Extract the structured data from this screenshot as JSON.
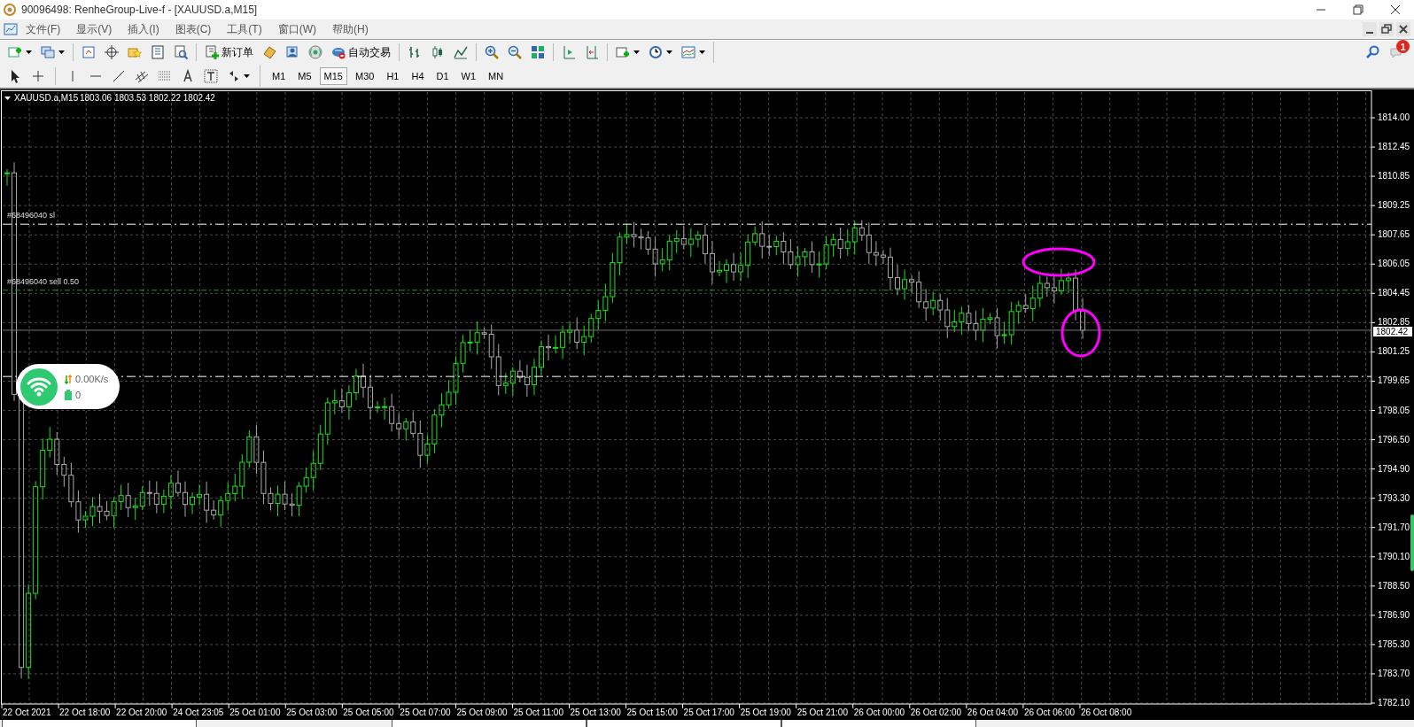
{
  "window": {
    "title": "90096498: RenheGroup-Live-f - [XAUUSD.a,M15]"
  },
  "menu": [
    "文件(F)",
    "显示(V)",
    "插入(I)",
    "图表(C)",
    "工具(T)",
    "窗口(W)",
    "帮助(H)"
  ],
  "toolbar": {
    "new_order": "新订单",
    "auto_trading": "自动交易",
    "notification_count": "1"
  },
  "timeframes": [
    {
      "label": "M1",
      "selected": false
    },
    {
      "label": "M5",
      "selected": false
    },
    {
      "label": "M15",
      "selected": true
    },
    {
      "label": "M30",
      "selected": false
    },
    {
      "label": "H1",
      "selected": false
    },
    {
      "label": "H4",
      "selected": false
    },
    {
      "label": "D1",
      "selected": false
    },
    {
      "label": "W1",
      "selected": false
    },
    {
      "label": "MN",
      "selected": false
    }
  ],
  "chart": {
    "symbol": "XAUUSD.a,M15",
    "ohlc": "1803.06 1803.53 1802.22 1802.42",
    "order_lines": [
      {
        "kind": "stop_loss",
        "label": "#68496040 sl"
      },
      {
        "kind": "order",
        "label": "#68496040 sell 0.50"
      },
      {
        "kind": "take_profit"
      }
    ],
    "current_price": "1802.42",
    "price_axis": [
      "1814.00",
      "1812.45",
      "1810.85",
      "1809.25",
      "1807.65",
      "1806.05",
      "1804.45",
      "1802.85",
      "1801.25",
      "1799.65",
      "1798.05",
      "1796.50",
      "1794.90",
      "1793.30",
      "1791.70",
      "1790.10",
      "1788.50",
      "1786.90",
      "1785.30",
      "1783.70",
      "1782.10"
    ],
    "time_axis": [
      "22 Oct 2021",
      "22 Oct 18:00",
      "22 Oct 20:00",
      "24 Oct 23:05",
      "25 Oct 01:00",
      "25 Oct 03:00",
      "25 Oct 05:00",
      "25 Oct 07:00",
      "25 Oct 09:00",
      "25 Oct 11:00",
      "25 Oct 13:00",
      "25 Oct 15:00",
      "25 Oct 17:00",
      "25 Oct 19:00",
      "25 Oct 21:00",
      "26 Oct 00:00",
      "26 Oct 02:00",
      "26 Oct 04:00",
      "26 Oct 06:00",
      "26 Oct 08:00"
    ]
  },
  "speed_widget": {
    "speed": "0.00K/s",
    "count": "0"
  }
}
